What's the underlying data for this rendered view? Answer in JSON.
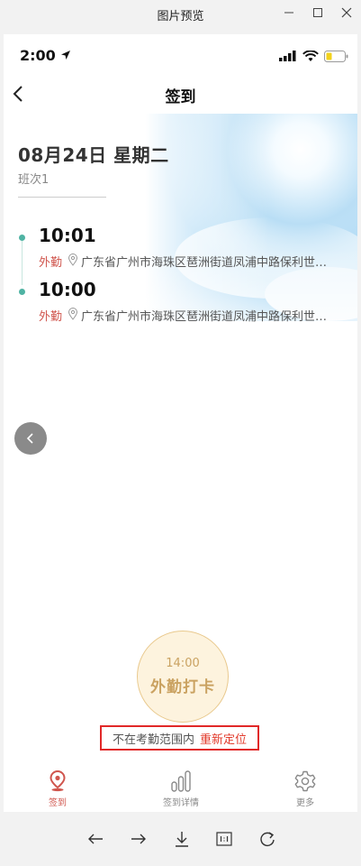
{
  "window": {
    "title": "图片预览"
  },
  "status_bar": {
    "time": "2:00"
  },
  "navbar": {
    "title": "签到"
  },
  "header": {
    "date": "08月24日 星期二",
    "shift": "班次1"
  },
  "records": [
    {
      "time": "10:01",
      "type": "外勤",
      "address": "广东省广州市海珠区琶洲街道凤浦中路保利世…"
    },
    {
      "time": "10:00",
      "type": "外勤",
      "address": "广东省广州市海珠区琶洲街道凤浦中路保利世…"
    }
  ],
  "punch_button": {
    "time": "14:00",
    "label": "外勤打卡"
  },
  "location_notice": {
    "text": "不在考勤范围内",
    "link": "重新定位"
  },
  "tabs": [
    {
      "label": "签到",
      "icon": "location-pin-icon",
      "active": true
    },
    {
      "label": "签到详情",
      "icon": "bar-chart-icon",
      "active": false
    },
    {
      "label": "更多",
      "icon": "gear-icon",
      "active": false
    }
  ],
  "colors": {
    "accent": "#d0564e",
    "teal": "#4fb3a3",
    "gold": "#caa261",
    "alert_border": "#e12828"
  }
}
